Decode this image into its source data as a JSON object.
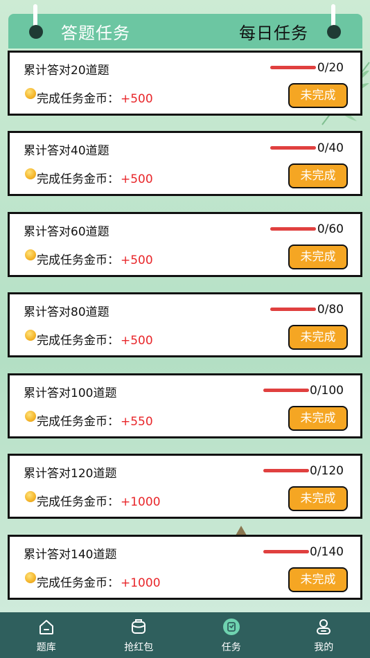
{
  "header": {
    "title_left": "答题任务",
    "title_right": "每日任务"
  },
  "colors": {
    "header_bg": "#6cc6a2",
    "progress": "#e0403f",
    "reward": "#e8262a",
    "button": "#f5a623",
    "nav_bg": "#2f5f5d"
  },
  "tasks": [
    {
      "name": "累计答对20道题",
      "progress": "0/20",
      "reward_label": "完成任务金币：",
      "reward_value": "+500",
      "status": "未完成"
    },
    {
      "name": "累计答对40道题",
      "progress": "0/40",
      "reward_label": "完成任务金币：",
      "reward_value": "+500",
      "status": "未完成"
    },
    {
      "name": "累计答对60道题",
      "progress": "0/60",
      "reward_label": "完成任务金币：",
      "reward_value": "+500",
      "status": "未完成"
    },
    {
      "name": "累计答对80道题",
      "progress": "0/80",
      "reward_label": "完成任务金币：",
      "reward_value": "+500",
      "status": "未完成"
    },
    {
      "name": "累计答对100道题",
      "progress": "0/100",
      "reward_label": "完成任务金币：",
      "reward_value": "+550",
      "status": "未完成"
    },
    {
      "name": "累计答对120道题",
      "progress": "0/120",
      "reward_label": "完成任务金币：",
      "reward_value": "+1000",
      "status": "未完成"
    },
    {
      "name": "累计答对140道题",
      "progress": "0/140",
      "reward_label": "完成任务金币：",
      "reward_value": "+1000",
      "status": "未完成"
    }
  ],
  "nav": {
    "items": [
      {
        "label": "题库",
        "icon": "home-icon"
      },
      {
        "label": "抢红包",
        "icon": "red-packet-icon"
      },
      {
        "label": "任务",
        "icon": "task-icon",
        "active": true
      },
      {
        "label": "我的",
        "icon": "user-icon"
      }
    ]
  }
}
